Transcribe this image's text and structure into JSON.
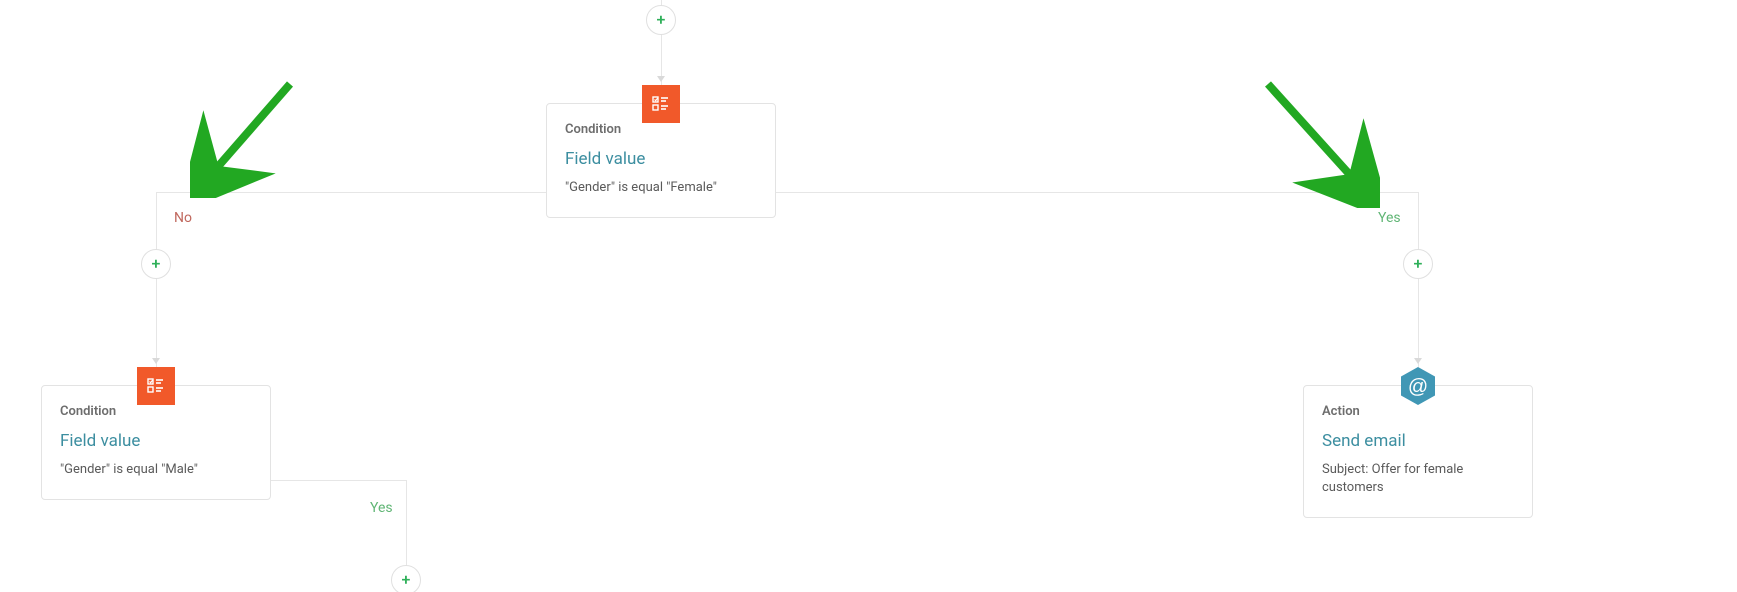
{
  "branches": {
    "no_label": "No",
    "yes_label": "Yes",
    "yes_label_inner": "Yes"
  },
  "add_glyph": "+",
  "nodes": {
    "condition_female": {
      "type": "Condition",
      "title": "Field value",
      "desc": "\"Gender\" is equal \"Female\""
    },
    "condition_male": {
      "type": "Condition",
      "title": "Field value",
      "desc": "\"Gender\" is equal \"Male\""
    },
    "action_send_email": {
      "type": "Action",
      "title": "Send email",
      "desc": "Subject: Offer for female customers"
    }
  },
  "colors": {
    "accent_teal": "#3c8ea0",
    "accent_orange": "#f1592a",
    "accent_blue": "#4097b5",
    "branch_no": "#c0675d",
    "branch_yes": "#5fb574",
    "plus_green": "#2fb05a"
  }
}
